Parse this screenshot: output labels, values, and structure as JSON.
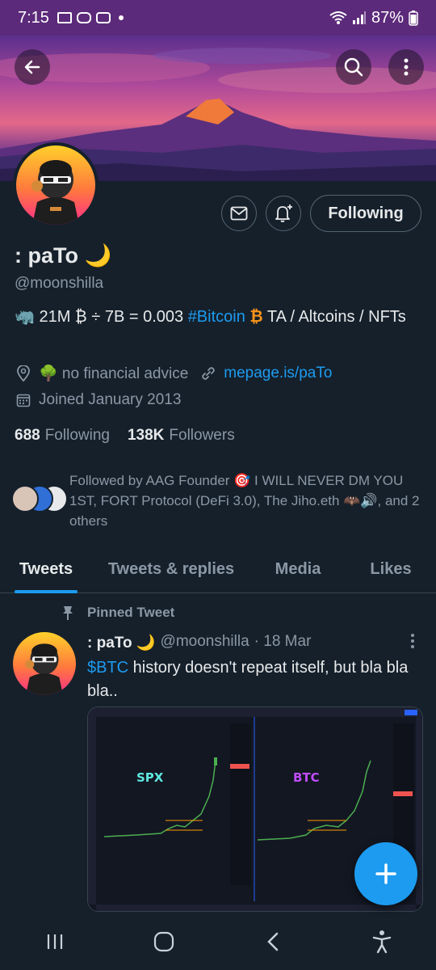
{
  "status_bar": {
    "time": "7:15",
    "battery": "87%"
  },
  "profile": {
    "name": ": paTo 🌙",
    "handle": "@moonshilla",
    "bio_prefix": "🦏 21M ₿ ÷ 7B = 0.003 ",
    "bio_hashtag": "#Bitcoin",
    "bio_btc_symbol": "₿",
    "bio_suffix": "  TA / Altcoins / NFTs",
    "location": "🌳  no financial advice",
    "website": "mepage.is/paTo",
    "joined": "Joined January 2013",
    "following_count": "688",
    "following_label": "Following",
    "followers_count": "138K",
    "followers_label": "Followers",
    "followed_by": "Followed by AAG Founder 🎯 I WILL NEVER DM YOU 1ST, FORT Protocol (DeFi 3.0), The Jiho.eth 🦇🔊, and 2 others"
  },
  "actions": {
    "following_button": "Following"
  },
  "tabs": [
    {
      "label": "Tweets"
    },
    {
      "label": "Tweets & replies"
    },
    {
      "label": "Media"
    },
    {
      "label": "Likes"
    }
  ],
  "tweet": {
    "pinned_label": "Pinned Tweet",
    "author_name": ": paTo 🌙",
    "author_handle": "@moonshilla",
    "date": "· 18 Mar",
    "text_link": "$BTC",
    "text_body": " history doesn't repeat itself, but bla bla bla..",
    "media_label_left": "SPX",
    "media_label_right": "BTC"
  },
  "colors": {
    "accent": "#1d9bf0",
    "background": "#15202b",
    "muted": "#8b98a5"
  }
}
